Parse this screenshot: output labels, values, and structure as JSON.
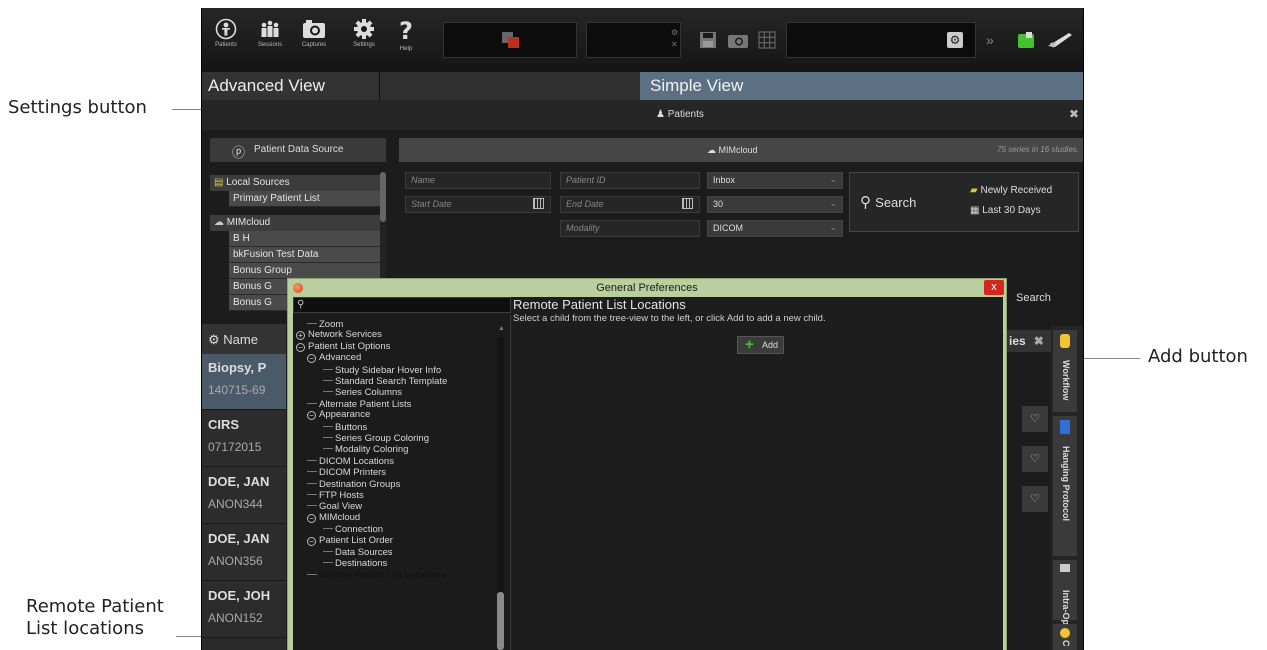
{
  "callouts": {
    "settings_button": "Settings button",
    "add_button": "Add button",
    "remote_locations_line1": "Remote Patient",
    "remote_locations_line2": "List locations"
  },
  "toolbar": {
    "patients": "Patients",
    "sessions": "Sessions",
    "captures": "Captures",
    "settings": "Settings",
    "help": "Help"
  },
  "views": {
    "advanced": "Advanced View",
    "simple": "Simple View"
  },
  "patients_header": "Patients",
  "data_source": {
    "title": "Patient Data Source",
    "local_sources": "Local Sources",
    "primary_list": "Primary Patient List",
    "mimcloud": "MIMcloud",
    "items": [
      "B H",
      "bkFusion Test Data",
      "Bonus Group",
      "Bonus G",
      "Bonus G"
    ]
  },
  "query": {
    "source_name": "MIMcloud",
    "series_count": "75 series in 16 studies.",
    "name_placeholder": "Name",
    "patient_id_placeholder": "Patient ID",
    "start_date_placeholder": "Start Date",
    "end_date_placeholder": "End Date",
    "modality_placeholder": "Modality",
    "inbox": "Inbox",
    "days": "30",
    "modality_value": "DICOM",
    "search": "Search",
    "newly_received": "Newly Received",
    "last_30_days": "Last 30 Days",
    "search2": "Search"
  },
  "patient_list": {
    "header": "Name",
    "rows": [
      {
        "name": "Biopsy, P",
        "id": "140715-69"
      },
      {
        "name": "CIRS",
        "id": "07172015"
      },
      {
        "name": "DOE, JAN",
        "id": "ANON344"
      },
      {
        "name": "DOE, JAN",
        "id": "ANON356"
      },
      {
        "name": "DOE, JOH",
        "id": "ANON152"
      }
    ]
  },
  "side_tabs": {
    "series_label": "ies",
    "workflow": "Workflow",
    "hanging_protocol": "Hanging Protocol",
    "intra_op": "Intra-Op",
    "partial": "C"
  },
  "dialog": {
    "title": "General Preferences",
    "close": "x",
    "tree": [
      {
        "label": "Zoom",
        "depth": 1,
        "node": "leaf"
      },
      {
        "label": "Network Services",
        "depth": 0,
        "node": "plus"
      },
      {
        "label": "Patient List Options",
        "depth": 0,
        "node": "minus"
      },
      {
        "label": "Advanced",
        "depth": 1,
        "node": "minus"
      },
      {
        "label": "Study Sidebar Hover Info",
        "depth": 2,
        "node": "leaf"
      },
      {
        "label": "Standard Search Template",
        "depth": 2,
        "node": "leaf"
      },
      {
        "label": "Series Columns",
        "depth": 2,
        "node": "leaf"
      },
      {
        "label": "Alternate Patient Lists",
        "depth": 1,
        "node": "leaf"
      },
      {
        "label": "Appearance",
        "depth": 1,
        "node": "minus"
      },
      {
        "label": "Buttons",
        "depth": 2,
        "node": "leaf"
      },
      {
        "label": "Series Group Coloring",
        "depth": 2,
        "node": "leaf"
      },
      {
        "label": "Modality Coloring",
        "depth": 2,
        "node": "leaf"
      },
      {
        "label": "DICOM Locations",
        "depth": 1,
        "node": "leaf"
      },
      {
        "label": "DICOM Printers",
        "depth": 1,
        "node": "leaf"
      },
      {
        "label": "Destination Groups",
        "depth": 1,
        "node": "leaf"
      },
      {
        "label": "FTP Hosts",
        "depth": 1,
        "node": "leaf"
      },
      {
        "label": "Goal View",
        "depth": 1,
        "node": "leaf"
      },
      {
        "label": "MIMcloud",
        "depth": 1,
        "node": "minus"
      },
      {
        "label": "Connection",
        "depth": 2,
        "node": "leaf"
      },
      {
        "label": "Patient List Order",
        "depth": 1,
        "node": "minus"
      },
      {
        "label": "Data Sources",
        "depth": 2,
        "node": "leaf"
      },
      {
        "label": "Destinations",
        "depth": 2,
        "node": "leaf"
      },
      {
        "label": "Remote Patient List Locations",
        "depth": 1,
        "node": "leaf",
        "selected": true
      }
    ],
    "content_title": "Remote Patient List Locations",
    "content_desc": "Select a child from the tree-view to the left, or click Add to add a new child.",
    "add": "Add"
  },
  "colors": {
    "dialog_frame": "#b9cf9d",
    "simple_view_tab": "#5b7082",
    "close_red": "#d2271f",
    "add_plus": "#44c22f"
  }
}
